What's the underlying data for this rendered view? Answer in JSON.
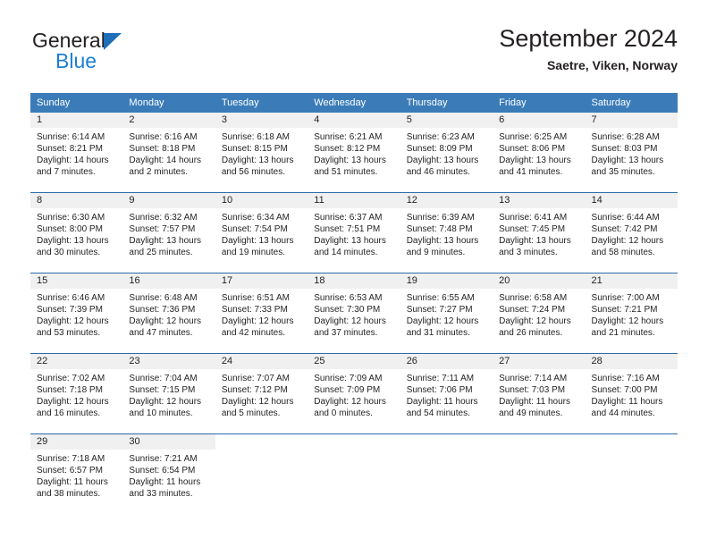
{
  "brand": {
    "name_part1": "General",
    "name_part2": "Blue",
    "logo_icon": "blue-triangle-logo"
  },
  "header": {
    "title": "September 2024",
    "subtitle": "Saetre, Viken, Norway"
  },
  "colors": {
    "header_blue": "#3b7cb8",
    "divider_blue": "#2a6ba8",
    "daynum_band": "#f0f0f0",
    "brand_blue": "#1b7fd4",
    "logo_blue": "#1e6eb8",
    "text": "#231f20"
  },
  "weekdays": [
    "Sunday",
    "Monday",
    "Tuesday",
    "Wednesday",
    "Thursday",
    "Friday",
    "Saturday"
  ],
  "weeks": [
    [
      {
        "day": "1",
        "sunrise": "Sunrise: 6:14 AM",
        "sunset": "Sunset: 8:21 PM",
        "daylight1": "Daylight: 14 hours",
        "daylight2": "and 7 minutes."
      },
      {
        "day": "2",
        "sunrise": "Sunrise: 6:16 AM",
        "sunset": "Sunset: 8:18 PM",
        "daylight1": "Daylight: 14 hours",
        "daylight2": "and 2 minutes."
      },
      {
        "day": "3",
        "sunrise": "Sunrise: 6:18 AM",
        "sunset": "Sunset: 8:15 PM",
        "daylight1": "Daylight: 13 hours",
        "daylight2": "and 56 minutes."
      },
      {
        "day": "4",
        "sunrise": "Sunrise: 6:21 AM",
        "sunset": "Sunset: 8:12 PM",
        "daylight1": "Daylight: 13 hours",
        "daylight2": "and 51 minutes."
      },
      {
        "day": "5",
        "sunrise": "Sunrise: 6:23 AM",
        "sunset": "Sunset: 8:09 PM",
        "daylight1": "Daylight: 13 hours",
        "daylight2": "and 46 minutes."
      },
      {
        "day": "6",
        "sunrise": "Sunrise: 6:25 AM",
        "sunset": "Sunset: 8:06 PM",
        "daylight1": "Daylight: 13 hours",
        "daylight2": "and 41 minutes."
      },
      {
        "day": "7",
        "sunrise": "Sunrise: 6:28 AM",
        "sunset": "Sunset: 8:03 PM",
        "daylight1": "Daylight: 13 hours",
        "daylight2": "and 35 minutes."
      }
    ],
    [
      {
        "day": "8",
        "sunrise": "Sunrise: 6:30 AM",
        "sunset": "Sunset: 8:00 PM",
        "daylight1": "Daylight: 13 hours",
        "daylight2": "and 30 minutes."
      },
      {
        "day": "9",
        "sunrise": "Sunrise: 6:32 AM",
        "sunset": "Sunset: 7:57 PM",
        "daylight1": "Daylight: 13 hours",
        "daylight2": "and 25 minutes."
      },
      {
        "day": "10",
        "sunrise": "Sunrise: 6:34 AM",
        "sunset": "Sunset: 7:54 PM",
        "daylight1": "Daylight: 13 hours",
        "daylight2": "and 19 minutes."
      },
      {
        "day": "11",
        "sunrise": "Sunrise: 6:37 AM",
        "sunset": "Sunset: 7:51 PM",
        "daylight1": "Daylight: 13 hours",
        "daylight2": "and 14 minutes."
      },
      {
        "day": "12",
        "sunrise": "Sunrise: 6:39 AM",
        "sunset": "Sunset: 7:48 PM",
        "daylight1": "Daylight: 13 hours",
        "daylight2": "and 9 minutes."
      },
      {
        "day": "13",
        "sunrise": "Sunrise: 6:41 AM",
        "sunset": "Sunset: 7:45 PM",
        "daylight1": "Daylight: 13 hours",
        "daylight2": "and 3 minutes."
      },
      {
        "day": "14",
        "sunrise": "Sunrise: 6:44 AM",
        "sunset": "Sunset: 7:42 PM",
        "daylight1": "Daylight: 12 hours",
        "daylight2": "and 58 minutes."
      }
    ],
    [
      {
        "day": "15",
        "sunrise": "Sunrise: 6:46 AM",
        "sunset": "Sunset: 7:39 PM",
        "daylight1": "Daylight: 12 hours",
        "daylight2": "and 53 minutes."
      },
      {
        "day": "16",
        "sunrise": "Sunrise: 6:48 AM",
        "sunset": "Sunset: 7:36 PM",
        "daylight1": "Daylight: 12 hours",
        "daylight2": "and 47 minutes."
      },
      {
        "day": "17",
        "sunrise": "Sunrise: 6:51 AM",
        "sunset": "Sunset: 7:33 PM",
        "daylight1": "Daylight: 12 hours",
        "daylight2": "and 42 minutes."
      },
      {
        "day": "18",
        "sunrise": "Sunrise: 6:53 AM",
        "sunset": "Sunset: 7:30 PM",
        "daylight1": "Daylight: 12 hours",
        "daylight2": "and 37 minutes."
      },
      {
        "day": "19",
        "sunrise": "Sunrise: 6:55 AM",
        "sunset": "Sunset: 7:27 PM",
        "daylight1": "Daylight: 12 hours",
        "daylight2": "and 31 minutes."
      },
      {
        "day": "20",
        "sunrise": "Sunrise: 6:58 AM",
        "sunset": "Sunset: 7:24 PM",
        "daylight1": "Daylight: 12 hours",
        "daylight2": "and 26 minutes."
      },
      {
        "day": "21",
        "sunrise": "Sunrise: 7:00 AM",
        "sunset": "Sunset: 7:21 PM",
        "daylight1": "Daylight: 12 hours",
        "daylight2": "and 21 minutes."
      }
    ],
    [
      {
        "day": "22",
        "sunrise": "Sunrise: 7:02 AM",
        "sunset": "Sunset: 7:18 PM",
        "daylight1": "Daylight: 12 hours",
        "daylight2": "and 16 minutes."
      },
      {
        "day": "23",
        "sunrise": "Sunrise: 7:04 AM",
        "sunset": "Sunset: 7:15 PM",
        "daylight1": "Daylight: 12 hours",
        "daylight2": "and 10 minutes."
      },
      {
        "day": "24",
        "sunrise": "Sunrise: 7:07 AM",
        "sunset": "Sunset: 7:12 PM",
        "daylight1": "Daylight: 12 hours",
        "daylight2": "and 5 minutes."
      },
      {
        "day": "25",
        "sunrise": "Sunrise: 7:09 AM",
        "sunset": "Sunset: 7:09 PM",
        "daylight1": "Daylight: 12 hours",
        "daylight2": "and 0 minutes."
      },
      {
        "day": "26",
        "sunrise": "Sunrise: 7:11 AM",
        "sunset": "Sunset: 7:06 PM",
        "daylight1": "Daylight: 11 hours",
        "daylight2": "and 54 minutes."
      },
      {
        "day": "27",
        "sunrise": "Sunrise: 7:14 AM",
        "sunset": "Sunset: 7:03 PM",
        "daylight1": "Daylight: 11 hours",
        "daylight2": "and 49 minutes."
      },
      {
        "day": "28",
        "sunrise": "Sunrise: 7:16 AM",
        "sunset": "Sunset: 7:00 PM",
        "daylight1": "Daylight: 11 hours",
        "daylight2": "and 44 minutes."
      }
    ],
    [
      {
        "day": "29",
        "sunrise": "Sunrise: 7:18 AM",
        "sunset": "Sunset: 6:57 PM",
        "daylight1": "Daylight: 11 hours",
        "daylight2": "and 38 minutes."
      },
      {
        "day": "30",
        "sunrise": "Sunrise: 7:21 AM",
        "sunset": "Sunset: 6:54 PM",
        "daylight1": "Daylight: 11 hours",
        "daylight2": "and 33 minutes."
      },
      {
        "day": "",
        "sunrise": "",
        "sunset": "",
        "daylight1": "",
        "daylight2": ""
      },
      {
        "day": "",
        "sunrise": "",
        "sunset": "",
        "daylight1": "",
        "daylight2": ""
      },
      {
        "day": "",
        "sunrise": "",
        "sunset": "",
        "daylight1": "",
        "daylight2": ""
      },
      {
        "day": "",
        "sunrise": "",
        "sunset": "",
        "daylight1": "",
        "daylight2": ""
      },
      {
        "day": "",
        "sunrise": "",
        "sunset": "",
        "daylight1": "",
        "daylight2": ""
      }
    ]
  ]
}
